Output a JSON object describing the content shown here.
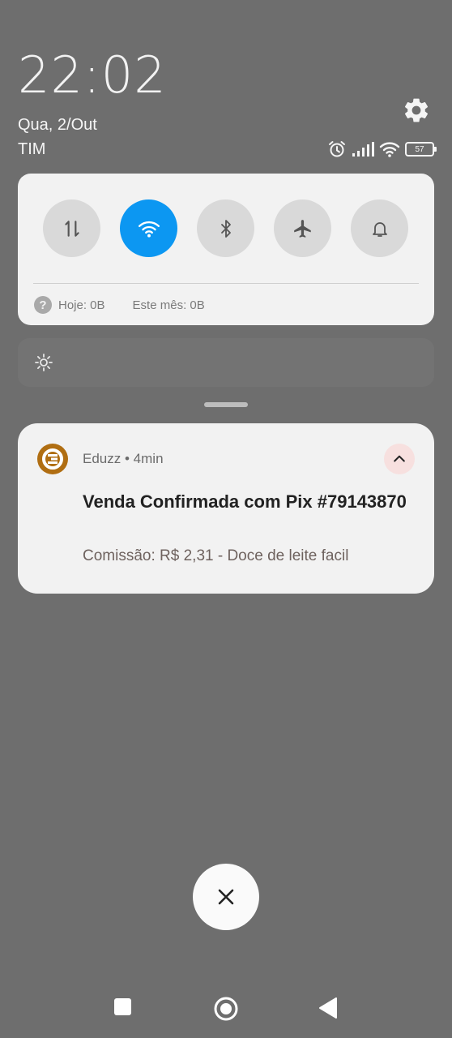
{
  "status": {
    "time": "22:02",
    "date": "Qua, 2/Out",
    "carrier": "TIM",
    "battery_level": "57",
    "icons": [
      "alarm-icon",
      "signal-icon",
      "wifi-icon",
      "battery-icon"
    ]
  },
  "quick_settings": {
    "toggles": [
      {
        "name": "mobile-data",
        "icon": "mobile-data-icon",
        "active": false
      },
      {
        "name": "wifi",
        "icon": "wifi-icon",
        "active": true
      },
      {
        "name": "bluetooth",
        "icon": "bluetooth-icon",
        "active": false
      },
      {
        "name": "airplane-mode",
        "icon": "airplane-icon",
        "active": false
      },
      {
        "name": "sound",
        "icon": "bell-icon",
        "active": false
      }
    ],
    "usage_help": "?",
    "usage_today": "Hoje: 0B",
    "usage_month": "Este mês: 0B",
    "accent_color": "#0c97f2"
  },
  "notification": {
    "app_name": "Eduzz",
    "separator": "•",
    "time_ago": "4min",
    "title": "Venda Confirmada com Pix #79143870",
    "body": "Comissão: R$ 2,31 - Doce de leite facil",
    "app_color": "#b06e12"
  },
  "navigation": {
    "buttons": [
      "recents-button",
      "home-button",
      "back-button"
    ]
  }
}
